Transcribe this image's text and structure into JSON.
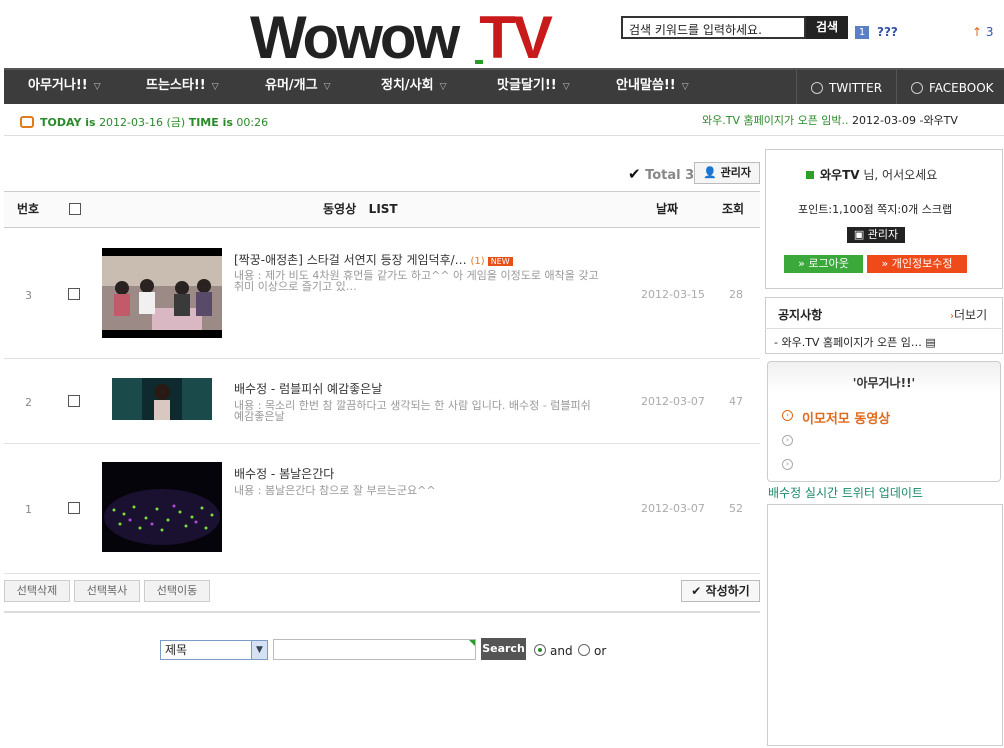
{
  "header": {
    "logo_left": "Wowow",
    "logo_right": "TV",
    "search_placeholder": "검색 키워드를 입력하세요.",
    "search_button": "검색",
    "badge": "1",
    "badge_text": "???",
    "up_count": "3"
  },
  "nav": {
    "items": [
      {
        "label": "아무거나!!"
      },
      {
        "label": "뜨는스타!!"
      },
      {
        "label": "유머/개그"
      },
      {
        "label": "정치/사회"
      },
      {
        "label": "맛글달기!!"
      },
      {
        "label": "안내말씀!!"
      }
    ],
    "twitter": "TWITTER",
    "facebook": "FACEBOOK"
  },
  "today_bar": {
    "today_label": "TODAY is",
    "today_value": "2012-03-16 (금)",
    "time_label": "TIME is",
    "time_value": "00:26",
    "ticker_link": "와우.TV 홈페이지가 오픈 임박..",
    "ticker_date": "2012-03-09 -와우TV"
  },
  "board": {
    "total_label": "Total 3",
    "admin_button": "관리자",
    "col_no": "번호",
    "col_title": "동영상",
    "col_list": "LIST",
    "col_date": "날짜",
    "col_hits": "조회",
    "rows": [
      {
        "num": "3",
        "title": "[짝꿍-애정촌] 스타걸 서연지 등장 게임덕후/…",
        "comments": "(1)",
        "new_badge": "NEW",
        "desc": "내용 : 제가 비도 4차원 휴먼들 같가도 하고^^ 아 게임을 이정도로 애착을 갖고 취미 이상으로 즐기고 있…",
        "date": "2012-03-15",
        "hits": "28"
      },
      {
        "num": "2",
        "title": "배수정 - 럼블피쉬 예감좋은날",
        "desc": "내용 : 목소리 한번 참 깔끔하다고 생각되는 한 사람 입니다. 배수정 - 럼블피쉬 예감좋은날",
        "date": "2012-03-07",
        "hits": "47"
      },
      {
        "num": "1",
        "title": "배수정 - 봄날은간다",
        "desc": "내용 : 봄날은간다 참으로 잘 부르는군요^^",
        "date": "2012-03-07",
        "hits": "52"
      }
    ],
    "btn_delete": "선택삭제",
    "btn_copy": "선택복사",
    "btn_move": "선택이동",
    "btn_write": "작성하기",
    "search_field_selected": "제목",
    "search_button": "Search",
    "radio_and": "and",
    "radio_or": "or"
  },
  "sidebar": {
    "welcome_name": "와우TV",
    "welcome_text": "님, 어서오세요",
    "points": "포인트:1,100점 쪽지:0개 스크랩",
    "admin_button": "관리자",
    "logout": "» 로그아웃",
    "edit_info": "» 개인정보수정",
    "notice_title": "공지사항",
    "notice_more": "더보기",
    "notice_item": "-  와우.TV 홈페이지가 오픈 임…",
    "category_title": "'아무거나!!'",
    "category_item": "이모저모 동영상",
    "twitter_title": "배수정 실시간 트위터 업데이트"
  }
}
